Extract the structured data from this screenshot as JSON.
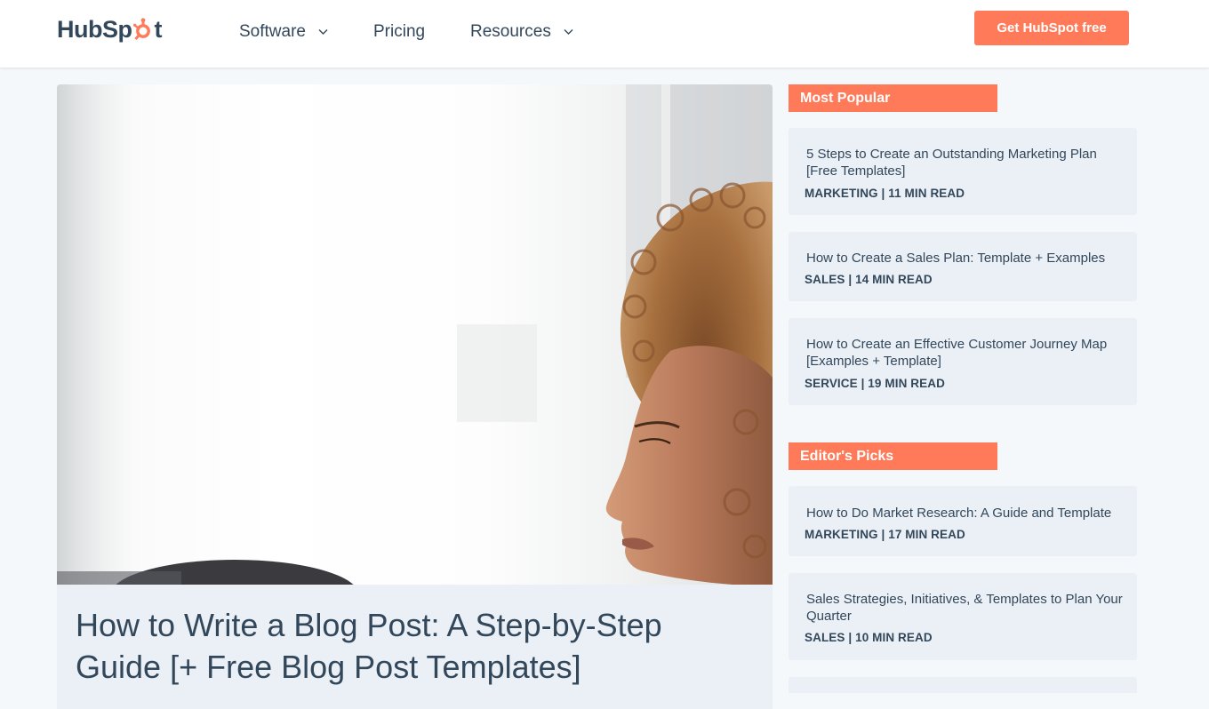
{
  "header": {
    "logo_text_1": "HubSp",
    "logo_text_2": "t",
    "nav": [
      {
        "label": "Software",
        "has_dropdown": true
      },
      {
        "label": "Pricing",
        "has_dropdown": false
      },
      {
        "label": "Resources",
        "has_dropdown": true
      }
    ],
    "cta_label": "Get HubSpot free"
  },
  "article": {
    "title": "How to Write a Blog Post: A Step-by-Step Guide [+ Free Blog Post Templates]"
  },
  "sidebar": {
    "most_popular": {
      "heading": "Most Popular",
      "items": [
        {
          "title": "5 Steps to Create an Outstanding Marketing Plan [Free Templates]",
          "meta": "MARKETING | 11 MIN READ"
        },
        {
          "title": "How to Create a Sales Plan: Template + Examples",
          "meta": "SALES | 14 MIN READ"
        },
        {
          "title": "How to Create an Effective Customer Journey Map [Examples + Template]",
          "meta": "SERVICE | 19 MIN READ"
        }
      ]
    },
    "editors_picks": {
      "heading": "Editor's Picks",
      "items": [
        {
          "title": "How to Do Market Research: A Guide and Template",
          "meta": "MARKETING | 17 MIN READ"
        },
        {
          "title": "Sales Strategies, Initiatives, & Templates to Plan Your Quarter",
          "meta": "SALES | 10 MIN READ"
        }
      ]
    }
  },
  "colors": {
    "brand_orange": "#ff7a59",
    "text_dark": "#33475b",
    "card_bg": "#eaf0f6"
  },
  "icons": {
    "logo": "hubspot-sprocket-icon",
    "dropdown": "chevron-down-icon"
  }
}
